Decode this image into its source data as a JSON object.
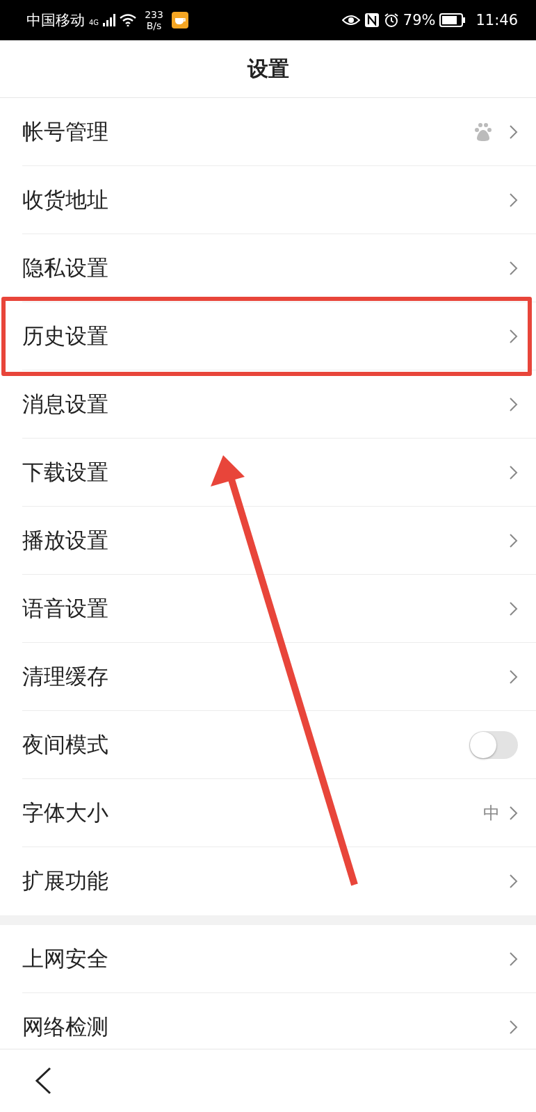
{
  "status_bar": {
    "carrier": "中国移动",
    "network": "4G",
    "speed": "233",
    "speed_unit": "B/s",
    "battery": "79%",
    "time": "11:46"
  },
  "title": "设置",
  "sections": [
    {
      "items": [
        {
          "label": "帐号管理",
          "kind": "account",
          "highlighted": false
        },
        {
          "label": "收货地址",
          "kind": "link",
          "highlighted": false
        },
        {
          "label": "隐私设置",
          "kind": "link",
          "highlighted": false
        },
        {
          "label": "历史设置",
          "kind": "link",
          "highlighted": true
        },
        {
          "label": "消息设置",
          "kind": "link",
          "highlighted": false
        },
        {
          "label": "下载设置",
          "kind": "link",
          "highlighted": false
        },
        {
          "label": "播放设置",
          "kind": "link",
          "highlighted": false
        },
        {
          "label": "语音设置",
          "kind": "link",
          "highlighted": false
        },
        {
          "label": "清理缓存",
          "kind": "link",
          "highlighted": false
        },
        {
          "label": "夜间模式",
          "kind": "toggle",
          "on": false,
          "highlighted": false
        },
        {
          "label": "字体大小",
          "kind": "value",
          "value": "中",
          "highlighted": false
        },
        {
          "label": "扩展功能",
          "kind": "link",
          "highlighted": false
        }
      ]
    },
    {
      "items": [
        {
          "label": "上网安全",
          "kind": "link",
          "highlighted": false
        },
        {
          "label": "网络检测",
          "kind": "link",
          "highlighted": false
        }
      ]
    }
  ]
}
